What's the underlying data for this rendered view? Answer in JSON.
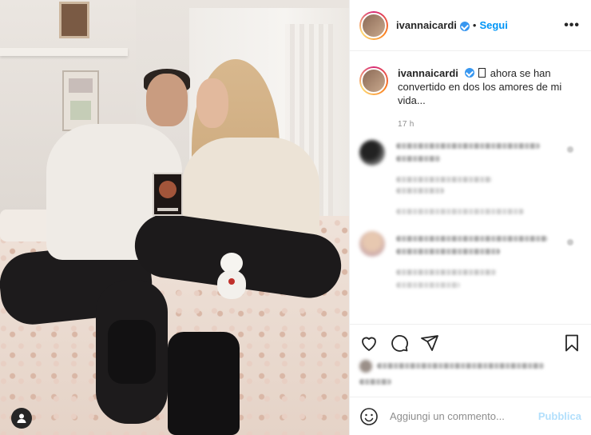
{
  "post": {
    "username": "ivannaicardi",
    "separator": "•",
    "follow_label": "Segui",
    "more_label": "•••",
    "caption_user": "ivannaicardi",
    "caption_text": "ahora se han convertido en dos los amores de mi vida...",
    "time_ago": "17 h"
  },
  "comment_box": {
    "placeholder": "Aggiungi un commento...",
    "publish_label": "Pubblica"
  },
  "icons": {
    "verified": "verified-badge-icon",
    "like": "heart-icon",
    "comment": "comment-bubble-icon",
    "share": "paper-plane-icon",
    "save": "bookmark-icon",
    "emoji": "smiley-icon",
    "user_tag": "user-tag-icon"
  },
  "colors": {
    "accent": "#0095f6",
    "publish_disabled": "#b2dffc",
    "muted": "#8e8e8e",
    "verified": "#3897f0"
  }
}
